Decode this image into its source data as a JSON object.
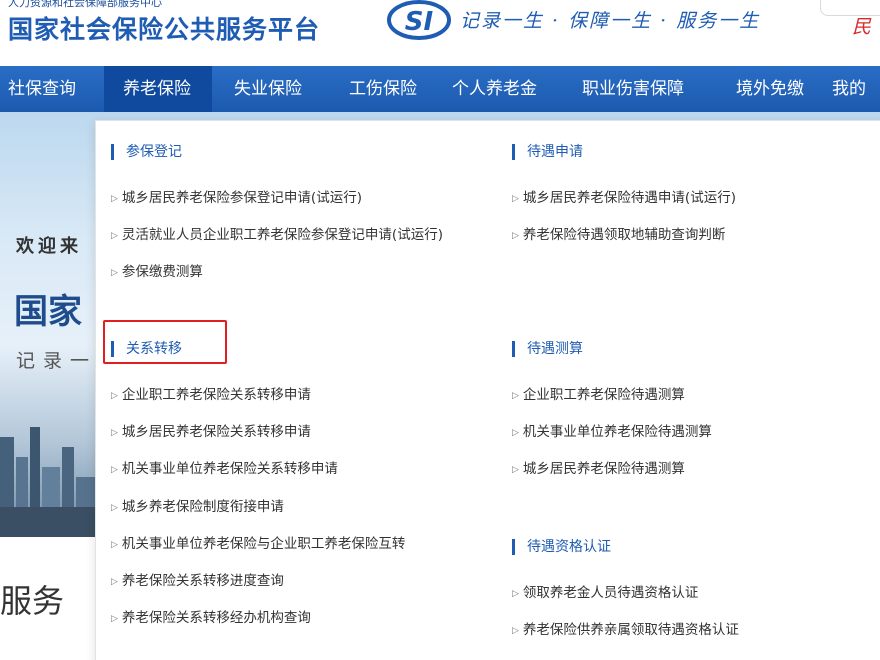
{
  "header": {
    "org_line": "人力资源和社会保障部服务中心",
    "site_title": "国家社会保险公共服务平台",
    "logo_text": "SI",
    "slogan": "记录一生 · 保障一生 · 服务一生",
    "right_text": "民"
  },
  "nav": {
    "items": [
      "社保查询",
      "养老保险",
      "失业保险",
      "工伤保险",
      "个人养老金",
      "职业伤害保障",
      "境外免缴",
      "我的"
    ],
    "active": "养老保险"
  },
  "banner": {
    "welcome": "欢迎来",
    "big": "国家",
    "sub": "记录一"
  },
  "services_text": "服务",
  "dropdown": {
    "left": [
      {
        "title": "参保登记",
        "items": [
          "城乡居民养老保险参保登记申请(试运行)",
          "灵活就业人员企业职工养老保险参保登记申请(试运行)",
          "参保缴费测算"
        ]
      },
      {
        "title": "关系转移",
        "items": [
          "企业职工养老保险关系转移申请",
          "城乡居民养老保险关系转移申请",
          "机关事业单位养老保险关系转移申请",
          "城乡养老保险制度衔接申请",
          "机关事业单位养老保险与企业职工养老保险互转",
          "养老保险关系转移进度查询",
          "养老保险关系转移经办机构查询"
        ]
      }
    ],
    "right": [
      {
        "title": "待遇申请",
        "items": [
          "城乡居民养老保险待遇申请(试运行)",
          "养老保险待遇领取地辅助查询判断"
        ]
      },
      {
        "title": "待遇测算",
        "items": [
          "企业职工养老保险待遇测算",
          "机关事业单位养老保险待遇测算",
          "城乡居民养老保险待遇测算"
        ]
      },
      {
        "title": "待遇资格认证",
        "items": [
          "领取养老金人员待遇资格认证",
          "养老保险供养亲属领取待遇资格认证"
        ]
      }
    ]
  },
  "colors": {
    "brand_blue": "#1f5cb3",
    "nav_blue": "#1c5aae",
    "nav_active": "#0f4a9f",
    "highlight_red": "#e02020"
  }
}
